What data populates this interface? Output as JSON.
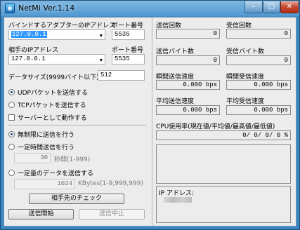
{
  "window": {
    "title": "NetMi Ver.1.14",
    "min_glyph": "–",
    "max_glyph": "□",
    "close_glyph": "✕"
  },
  "left": {
    "bind_label": "バインドするアダプターのIPアドレス",
    "bind_ip": "127.0.0.1",
    "port_label_1": "ポート番号",
    "bind_port": "5535",
    "peer_label": "相手のIPアドレス",
    "peer_ip": "127.0.0.1",
    "port_label_2": "ポート番号",
    "peer_port": "5535",
    "datasize_label": "データサイズ(9999バイト以下)",
    "datasize": "512",
    "radio_udp": "UDPパケットを送信する",
    "radio_tcp": "TCPパケットを送信する",
    "check_server": "サーバーとして動作する",
    "radio_unlimited": "無制限に送信を行う",
    "radio_timed": "一定時間送信を行う",
    "timed_value": "30",
    "timed_unit": "秒間(1-999)",
    "radio_amount": "一定量のデータを送信する",
    "amount_value": "1024",
    "amount_unit": "KBytes(1-9,999,999)",
    "check_peer_button": "相手先のチェック",
    "start_button": "送信開始",
    "stop_button": "送信中止",
    "selected_protocol": "UDP",
    "selected_mode": "unlimited"
  },
  "right": {
    "sent_count_label": "送信回数",
    "sent_count": "0",
    "recv_count_label": "受信回数",
    "recv_count": "0",
    "sent_bytes_label": "送信バイト数",
    "sent_bytes": "0",
    "recv_bytes_label": "受信バイト数",
    "recv_bytes": "0",
    "inst_send_label": "瞬間送信速度",
    "inst_send": "0.000 bps",
    "inst_recv_label": "瞬間受信速度",
    "inst_recv": "0.000 bps",
    "avg_send_label": "平均送信速度",
    "avg_send": "0.000 bps",
    "avg_recv_label": "平均受信速度",
    "avg_recv": "0.000 bps",
    "cpu_label": "CPU使用率(現在値/平均値/最高値/最低値)",
    "cpu_value": "0/  0/  0/  0 %",
    "ip_label": "IP アドレス:"
  }
}
